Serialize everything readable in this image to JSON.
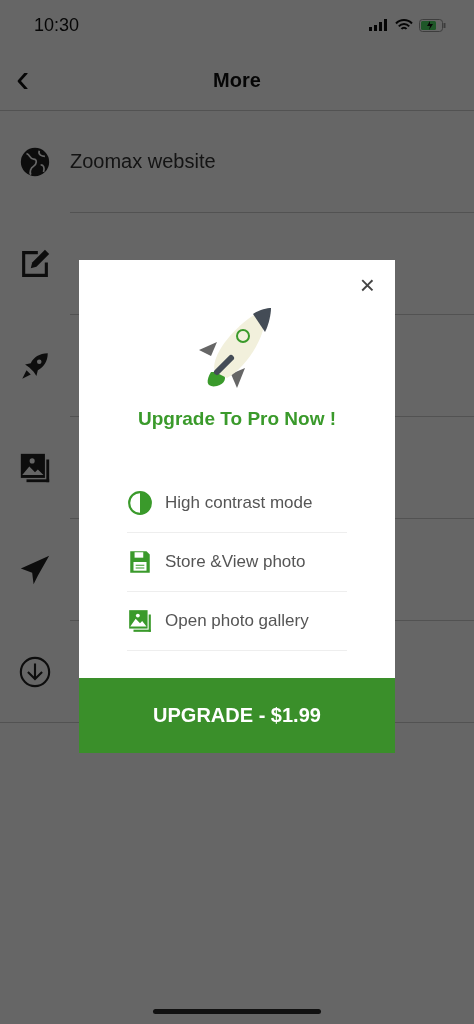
{
  "status_bar": {
    "time": "10:30"
  },
  "header": {
    "back": "‹",
    "title": "More"
  },
  "menu": [
    {
      "kind": "globe",
      "label": "Zoomax website"
    },
    {
      "kind": "edit"
    },
    {
      "kind": "rocket"
    },
    {
      "kind": "gallery"
    },
    {
      "kind": "send"
    },
    {
      "kind": "download"
    }
  ],
  "dialog": {
    "close": "×",
    "title": "Upgrade To Pro Now !",
    "features": [
      {
        "kind": "contrast",
        "label": "High contrast mode"
      },
      {
        "kind": "save",
        "label": "Store &View photo"
      },
      {
        "kind": "gallery",
        "label": "Open photo gallery"
      }
    ],
    "button": "UPGRADE - $1.99"
  }
}
